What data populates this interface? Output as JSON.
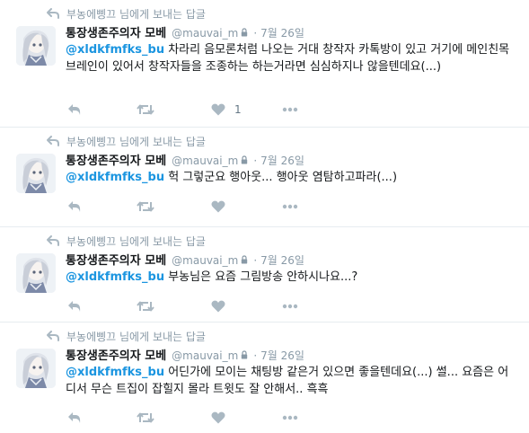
{
  "tweets": [
    {
      "reply_context": "부농에삥끄 님에게 보내는 답글",
      "name": "통장생존주의자 모베",
      "handle": "@mauvai_m",
      "time": "7월 26일",
      "mention": "@xldkfmfks_bu",
      "body": " 차라리 음모론처럼 나오는 거대 창작자 카톡방이 있고 거기에 메인친목브레인이 있어서 창작자들을 조종하는 하는거라면 심심하지나 않을텐데요(...)",
      "like_count": "1"
    },
    {
      "reply_context": "부농에삥끄 님에게 보내는 답글",
      "name": "통장생존주의자 모베",
      "handle": "@mauvai_m",
      "time": "7월 26일",
      "mention": "@xldkfmfks_bu",
      "body": " 헉 그렇군요 행아웃... 행아웃 염탐하고파라(...)",
      "like_count": ""
    },
    {
      "reply_context": "부농에삥끄 님에게 보내는 답글",
      "name": "통장생존주의자 모베",
      "handle": "@mauvai_m",
      "time": "7월 26일",
      "mention": "@xldkfmfks_bu",
      "body": " 부농님은 요즘 그림방송 안하시나요...?",
      "like_count": ""
    },
    {
      "reply_context": "부농에삥끄 님에게 보내는 답글",
      "name": "통장생존주의자 모베",
      "handle": "@mauvai_m",
      "time": "7월 26일",
      "mention": "@xldkfmfks_bu",
      "body": " 어딘가에 모이는 채팅방 같은거 있으면 좋을텐데요(...) 썰... 요즘은 어디서 무슨 트집이 잡힐지 몰라 트윗도 잘 안해서.. 흑흑",
      "like_count": ""
    }
  ],
  "icons": {
    "reply": "reply-icon",
    "retweet": "retweet-icon",
    "like": "heart-icon",
    "more": "more-icon",
    "lock": "lock-icon",
    "reply_context": "reply-arrow-icon"
  },
  "colors": {
    "mention": "#1b95e0",
    "muted": "#8899a6",
    "icon": "#aab8c2",
    "divider": "#e6ecf0"
  }
}
